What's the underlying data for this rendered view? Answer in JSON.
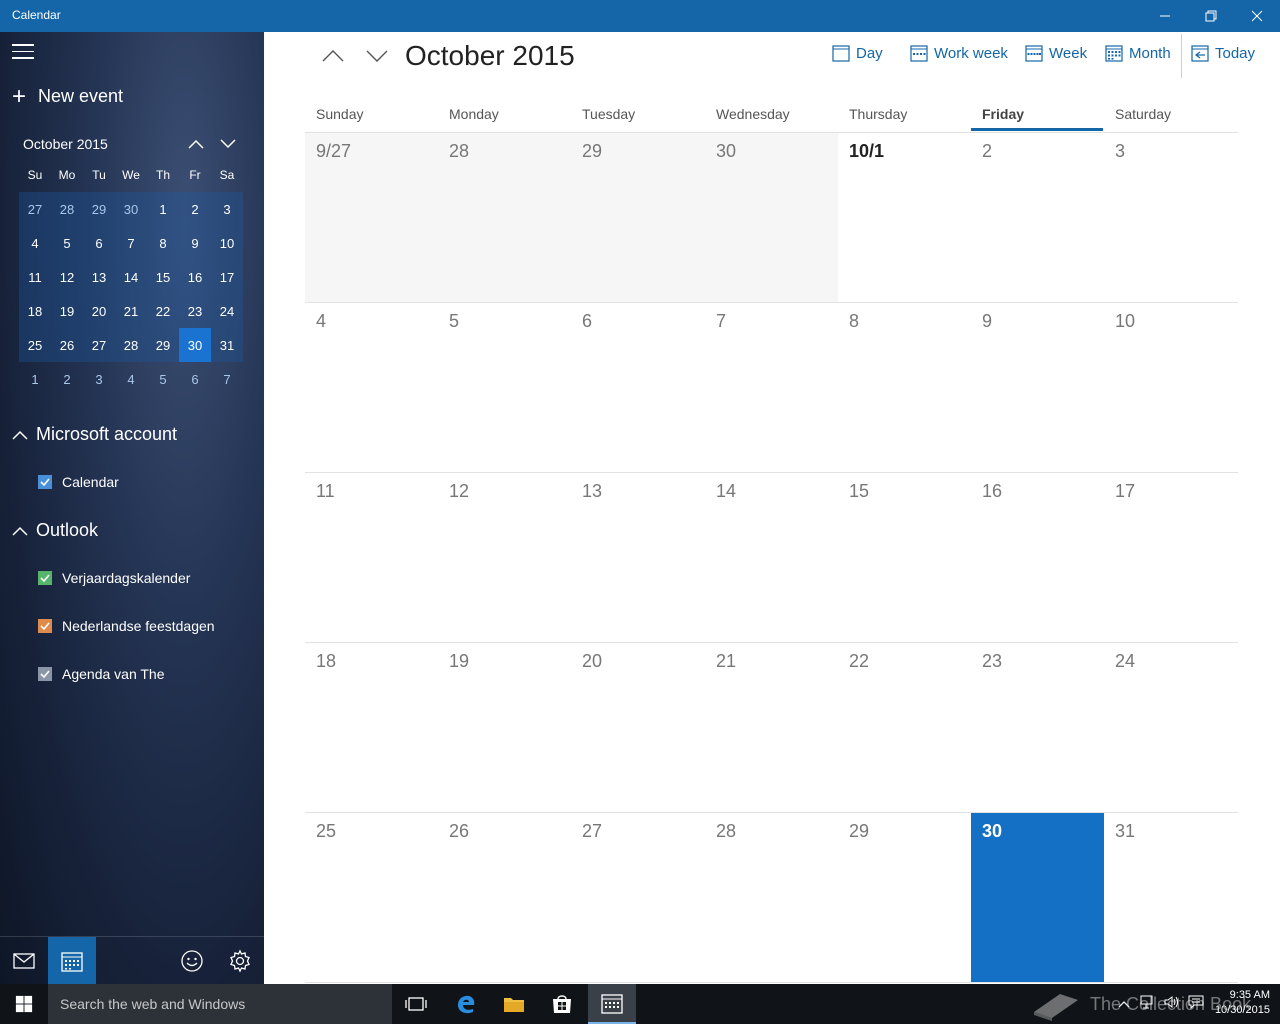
{
  "window": {
    "title": "Calendar"
  },
  "sidebar": {
    "new_event": "New event",
    "mini": {
      "title": "October 2015",
      "dow": [
        "Su",
        "Mo",
        "Tu",
        "We",
        "Th",
        "Fr",
        "Sa"
      ],
      "weeks": [
        [
          "27",
          "28",
          "29",
          "30",
          "1",
          "2",
          "3"
        ],
        [
          "4",
          "5",
          "6",
          "7",
          "8",
          "9",
          "10"
        ],
        [
          "11",
          "12",
          "13",
          "14",
          "15",
          "16",
          "17"
        ],
        [
          "18",
          "19",
          "20",
          "21",
          "22",
          "23",
          "24"
        ],
        [
          "25",
          "26",
          "27",
          "28",
          "29",
          "30",
          "31"
        ],
        [
          "1",
          "2",
          "3",
          "4",
          "5",
          "6",
          "7"
        ]
      ]
    },
    "accounts": [
      {
        "name": "Microsoft account",
        "calendars": [
          {
            "name": "Calendar",
            "color": "#4a90d9"
          }
        ]
      },
      {
        "name": "Outlook",
        "calendars": [
          {
            "name": "Verjaardagskalender",
            "color": "#56b46b"
          },
          {
            "name": "Nederlandse feestdagen",
            "color": "#e08a4c"
          },
          {
            "name": "Agenda van The",
            "color": "#8a96a8"
          }
        ]
      }
    ]
  },
  "main": {
    "title": "October 2015",
    "views": {
      "day": "Day",
      "work_week": "Work week",
      "week": "Week",
      "month": "Month",
      "today": "Today"
    },
    "dow": [
      "Sunday",
      "Monday",
      "Tuesday",
      "Wednesday",
      "Thursday",
      "Friday",
      "Saturday"
    ],
    "weeks": [
      [
        "9/27",
        "28",
        "29",
        "30",
        "10/1",
        "2",
        "3"
      ],
      [
        "4",
        "5",
        "6",
        "7",
        "8",
        "9",
        "10"
      ],
      [
        "11",
        "12",
        "13",
        "14",
        "15",
        "16",
        "17"
      ],
      [
        "18",
        "19",
        "20",
        "21",
        "22",
        "23",
        "24"
      ],
      [
        "25",
        "26",
        "27",
        "28",
        "29",
        "30",
        "31"
      ]
    ]
  },
  "taskbar": {
    "search_placeholder": "Search the web and Windows",
    "time": "9:35 AM",
    "date": "10/30/2015",
    "watermark": "The Collection Book"
  },
  "colors": {
    "accent": "#1466a8",
    "today": "#1470c4"
  }
}
